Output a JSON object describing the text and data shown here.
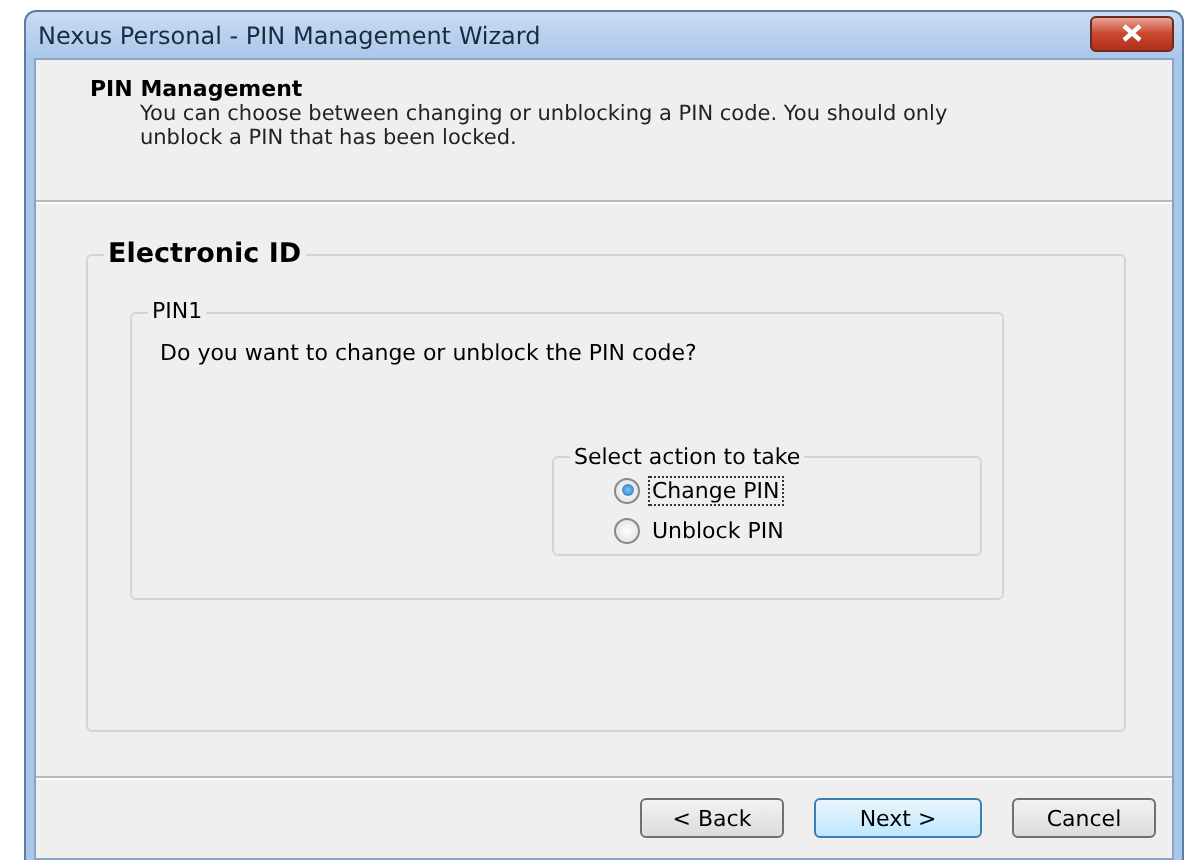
{
  "window": {
    "title": "Nexus Personal - PIN Management Wizard"
  },
  "header": {
    "title": "PIN Management",
    "description": "You can choose between changing or unblocking a PIN code. You should only unblock a PIN that has been locked."
  },
  "group": {
    "title": "Electronic ID",
    "pin_group": {
      "title": "PIN1",
      "question": "Do you want to change or unblock the PIN code?",
      "action_group": {
        "title": "Select action to take",
        "options": [
          {
            "label": "Change PIN",
            "selected": true
          },
          {
            "label": "Unblock PIN",
            "selected": false
          }
        ]
      }
    }
  },
  "buttons": [
    {
      "label": "< Back",
      "default": false
    },
    {
      "label": "Next >",
      "default": true
    },
    {
      "label": "Cancel",
      "default": false
    }
  ]
}
